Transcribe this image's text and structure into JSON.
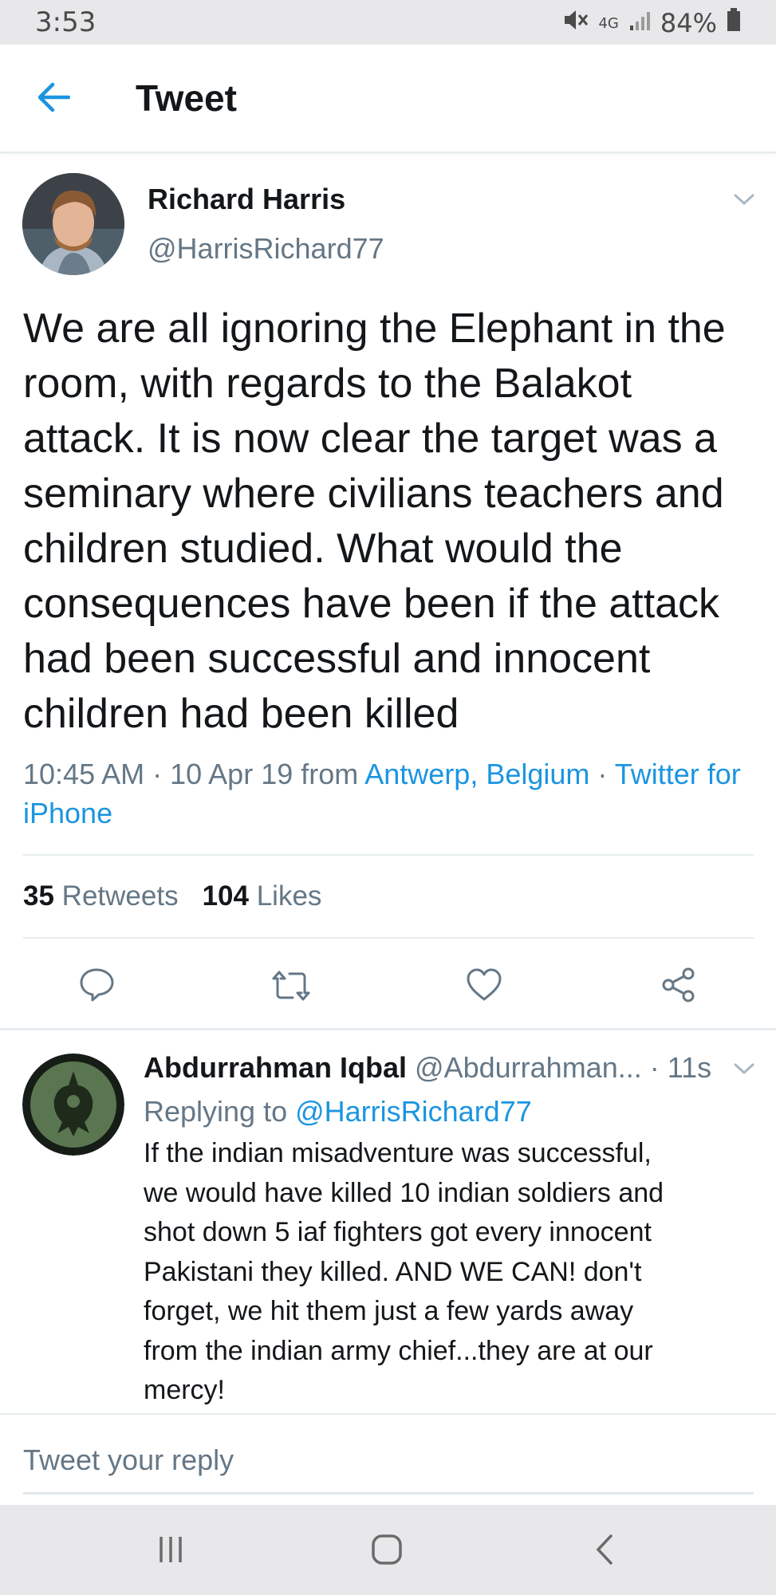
{
  "status_bar": {
    "time": "3:53",
    "network": "4G",
    "battery": "84%"
  },
  "header": {
    "title": "Tweet"
  },
  "tweet": {
    "author_name": "Richard Harris",
    "author_handle": "@HarrisRichard77",
    "text": "We are all ignoring the Elephant in the room, with regards to the Balakot attack. It is now clear the target was a seminary where civilians teachers and children studied. What would the consequences have been if the attack had been successful and innocent children had been killed",
    "time": "10:45 AM",
    "sep1": " · ",
    "date": "10 Apr 19",
    "from_word": " from ",
    "location": "Antwerp, Belgium",
    "sep2": " · ",
    "source": "Twitter for iPhone",
    "retweets_count": "35",
    "retweets_label": "Retweets",
    "likes_count": "104",
    "likes_label": "Likes"
  },
  "reply": {
    "author_name": "Abdurrahman Iqbal",
    "author_handle": "@Abdurrahman...",
    "time_ago": "· 11s",
    "replying_prefix": "Replying to ",
    "replying_handle": "@HarrisRichard77",
    "lines": [
      "If the indian misadventure was successful,",
      "we would have killed 10 indian soldiers and",
      "shot down 5 iaf  fighters got every innocent",
      "Pakistani they killed.   AND WE CAN!  don't",
      "forget, we hit them just a few yards away",
      "from the indian army chief...they are at our",
      "mercy!"
    ]
  },
  "compose": {
    "placeholder": "Tweet your reply"
  },
  "colors": {
    "accent": "#1b95e0",
    "muted": "#657786",
    "divider": "#e6ecf0",
    "status_bar_bg": "#e8e8ea"
  }
}
